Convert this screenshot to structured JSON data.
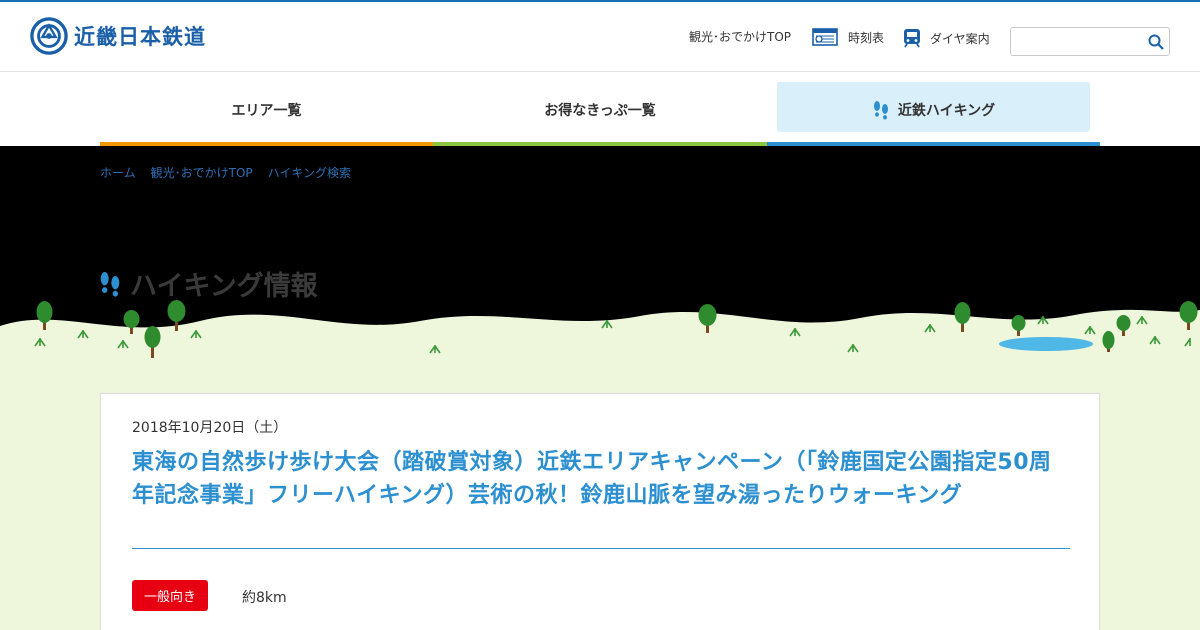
{
  "header": {
    "logo_text": "近畿日本鉄道",
    "nav": {
      "sightseeing_top": "観光･おでかけTOP",
      "timetable": "時刻表",
      "dia": "ダイヤ案内"
    },
    "search": {
      "value": "",
      "placeholder": ""
    }
  },
  "main_nav": {
    "tabs": [
      {
        "label": "エリア一覧",
        "color": "#f39800"
      },
      {
        "label": "お得なきっぷ一覧",
        "color": "#8cc63f"
      },
      {
        "label": "近鉄ハイキング",
        "color": "#2b8fd0",
        "active": true
      }
    ]
  },
  "breadcrumb": [
    "ホーム",
    "観光･おでかけTOP",
    "ハイキング検索"
  ],
  "hero": {
    "title": "ハイキング情報"
  },
  "event": {
    "date": "2018年10月20日（土）",
    "title": "東海の自然歩け歩け大会（踏破賞対象）近鉄エリアキャンペーン（「鈴鹿国定公園指定50周年記念事業」フリーハイキング）芸術の秋！鈴鹿山脈を望み湯ったりウォーキング",
    "level_badge": "一般向き",
    "distance": "約8km"
  },
  "colors": {
    "brand": "#1a5fa8",
    "title_blue": "#2b8fd0",
    "badge_red": "#e60012",
    "ground": "#eef6dc"
  }
}
